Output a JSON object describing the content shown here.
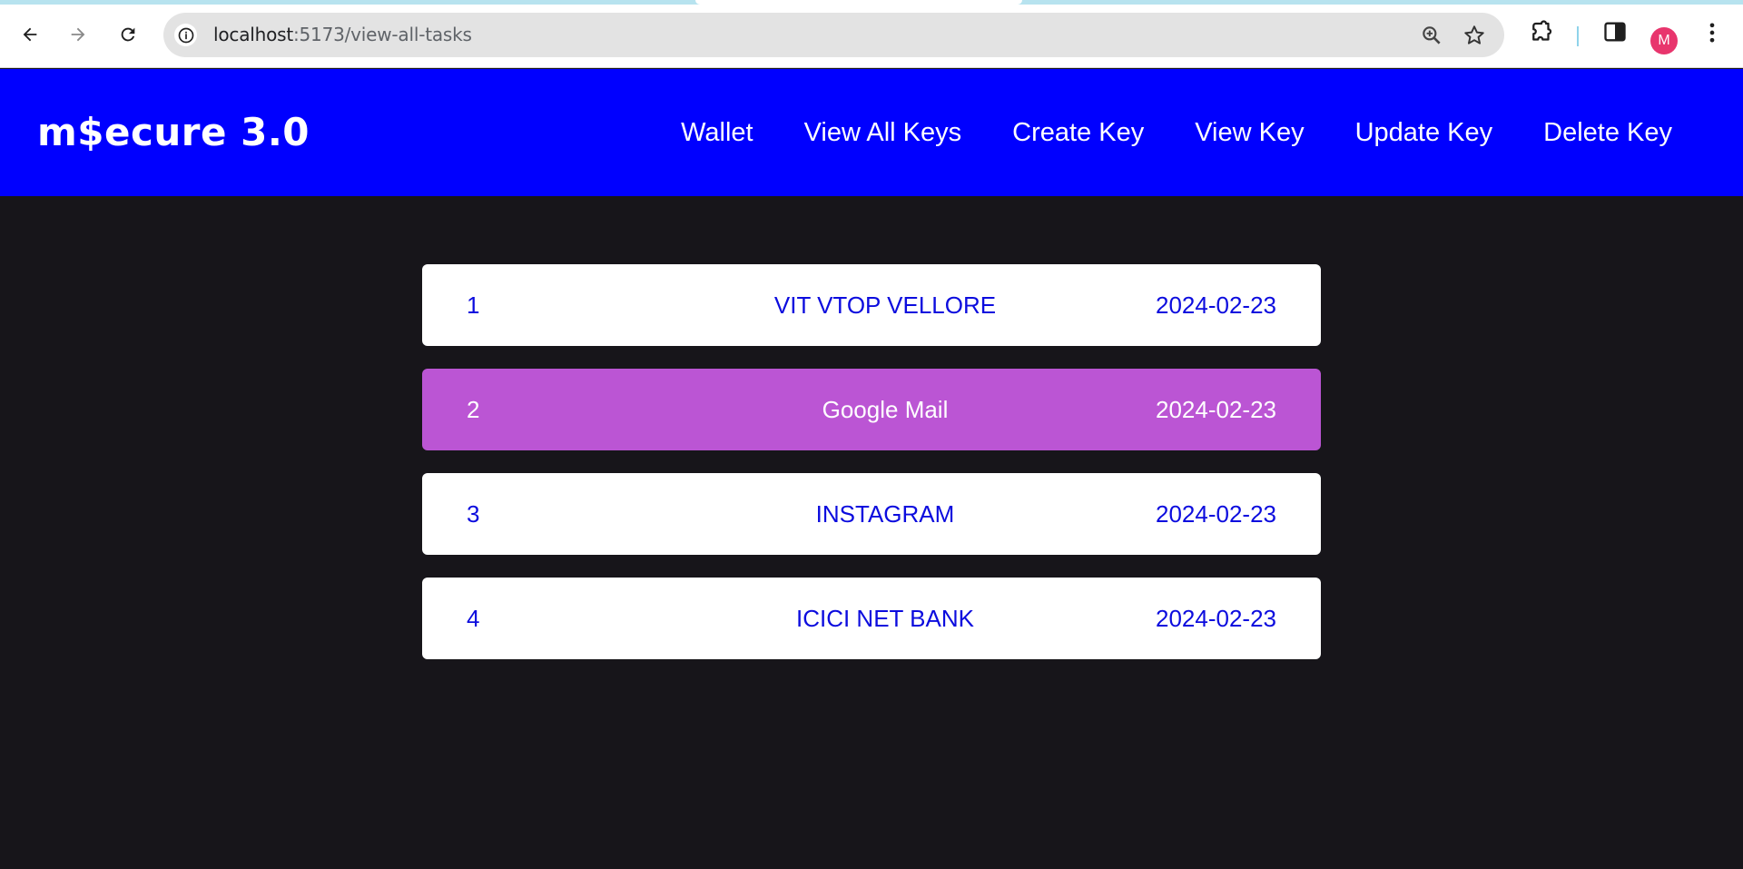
{
  "browser": {
    "url_host": "localhost",
    "url_path": ":5173/view-all-tasks",
    "profile_initial": "M",
    "icons": [
      "back-icon",
      "forward-icon",
      "reload-icon",
      "info-icon",
      "zoom-icon",
      "star-icon",
      "extensions-icon",
      "side-panel-icon",
      "menu-dots-icon"
    ]
  },
  "header": {
    "brand": "m$ecure 3.0",
    "nav": [
      "Wallet",
      "View All Keys",
      "Create Key",
      "View Key",
      "Update Key",
      "Delete Key"
    ]
  },
  "keys": [
    {
      "id": "1",
      "name": "VIT VTOP VELLORE",
      "date": "2024-02-23"
    },
    {
      "id": "2",
      "name": "Google Mail",
      "date": "2024-02-23"
    },
    {
      "id": "3",
      "name": "INSTAGRAM",
      "date": "2024-02-23"
    },
    {
      "id": "4",
      "name": "ICICI NET BANK",
      "date": "2024-02-23"
    }
  ],
  "colors": {
    "header_bg": "#0000ff",
    "page_bg": "#17151a",
    "row_bg": "#ffffff",
    "row_text": "#0c0cde",
    "row_active_bg": "#bb55d4",
    "avatar_bg": "#e8356d"
  }
}
